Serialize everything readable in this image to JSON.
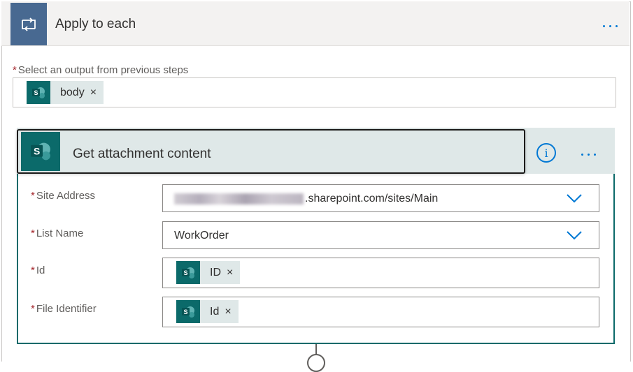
{
  "apply_to_each": {
    "title": "Apply to each",
    "more_icon": "ellipsis-icon",
    "loop_icon": "loop-icon",
    "select_label": "Select an output from previous steps",
    "required_mark": "*",
    "token": {
      "label": "body",
      "close": "×",
      "icon": "sharepoint-icon"
    }
  },
  "action": {
    "title": "Get attachment content",
    "info_glyph": "i",
    "icon": "sharepoint-icon",
    "fields": [
      {
        "label": "Site Address",
        "value": ".sharepoint.com/sites/Main",
        "type": "dropdown"
      },
      {
        "label": "List Name",
        "value": "WorkOrder",
        "type": "dropdown"
      },
      {
        "label": "Id",
        "token": "ID",
        "close": "×",
        "type": "token"
      },
      {
        "label": "File Identifier",
        "token": "Id",
        "close": "×",
        "type": "token"
      }
    ]
  },
  "colors": {
    "loop_accent": "#486991",
    "sharepoint": "#0b6a6a",
    "link": "#0078d4",
    "required": "#a4262c"
  }
}
